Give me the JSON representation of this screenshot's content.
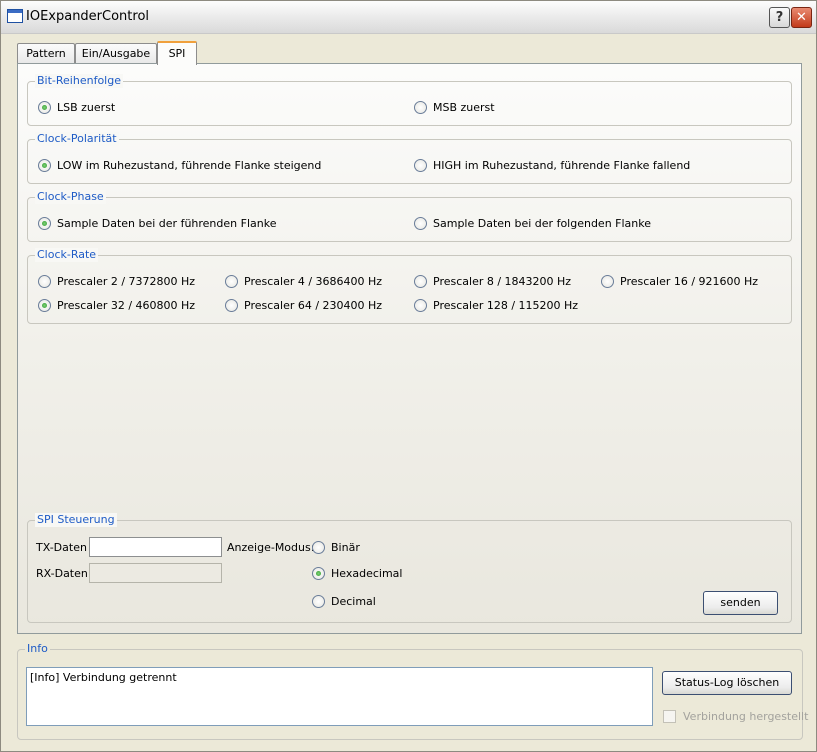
{
  "window": {
    "title": "IOExpanderControl",
    "help_symbol": "?",
    "close_symbol": "✕"
  },
  "tabs": [
    {
      "label": "Pattern",
      "active": false
    },
    {
      "label": "Ein/Ausgabe",
      "active": false
    },
    {
      "label": "SPI",
      "active": true
    }
  ],
  "bit_order": {
    "legend": "Bit-Reihenfolge",
    "options": [
      {
        "label": "LSB zuerst",
        "checked": true
      },
      {
        "label": "MSB zuerst",
        "checked": false
      }
    ]
  },
  "clock_polarity": {
    "legend": "Clock-Polarität",
    "options": [
      {
        "label": "LOW im Ruhezustand, führende Flanke steigend",
        "checked": true
      },
      {
        "label": "HIGH im Ruhezustand, führende Flanke fallend",
        "checked": false
      }
    ]
  },
  "clock_phase": {
    "legend": "Clock-Phase",
    "options": [
      {
        "label": "Sample Daten bei der führenden Flanke",
        "checked": true
      },
      {
        "label": "Sample Daten bei der folgenden Flanke",
        "checked": false
      }
    ]
  },
  "clock_rate": {
    "legend": "Clock-Rate",
    "options": [
      {
        "label": "Prescaler 2 / 7372800 Hz",
        "checked": false
      },
      {
        "label": "Prescaler 4 / 3686400 Hz",
        "checked": false
      },
      {
        "label": "Prescaler 8 / 1843200 Hz",
        "checked": false
      },
      {
        "label": "Prescaler 16 / 921600 Hz",
        "checked": false
      },
      {
        "label": "Prescaler 32 / 460800 Hz",
        "checked": true
      },
      {
        "label": "Prescaler 64 / 230400 Hz",
        "checked": false
      },
      {
        "label": "Prescaler 128 / 115200 Hz",
        "checked": false
      }
    ]
  },
  "spi_control": {
    "legend": "SPI Steuerung",
    "tx_label": "TX-Daten",
    "tx_value": "",
    "rx_label": "RX-Daten",
    "rx_value": "",
    "mode_label": "Anzeige-Modus:",
    "modes": [
      {
        "label": "Binär",
        "checked": false
      },
      {
        "label": "Hexadecimal",
        "checked": true
      },
      {
        "label": "Decimal",
        "checked": false
      }
    ],
    "send_label": "senden"
  },
  "info": {
    "legend": "Info",
    "log_text": "[Info] Verbindung getrennt",
    "clear_label": "Status-Log löschen",
    "connected_label": "Verbindung hergestellt",
    "connected_checked": false
  }
}
